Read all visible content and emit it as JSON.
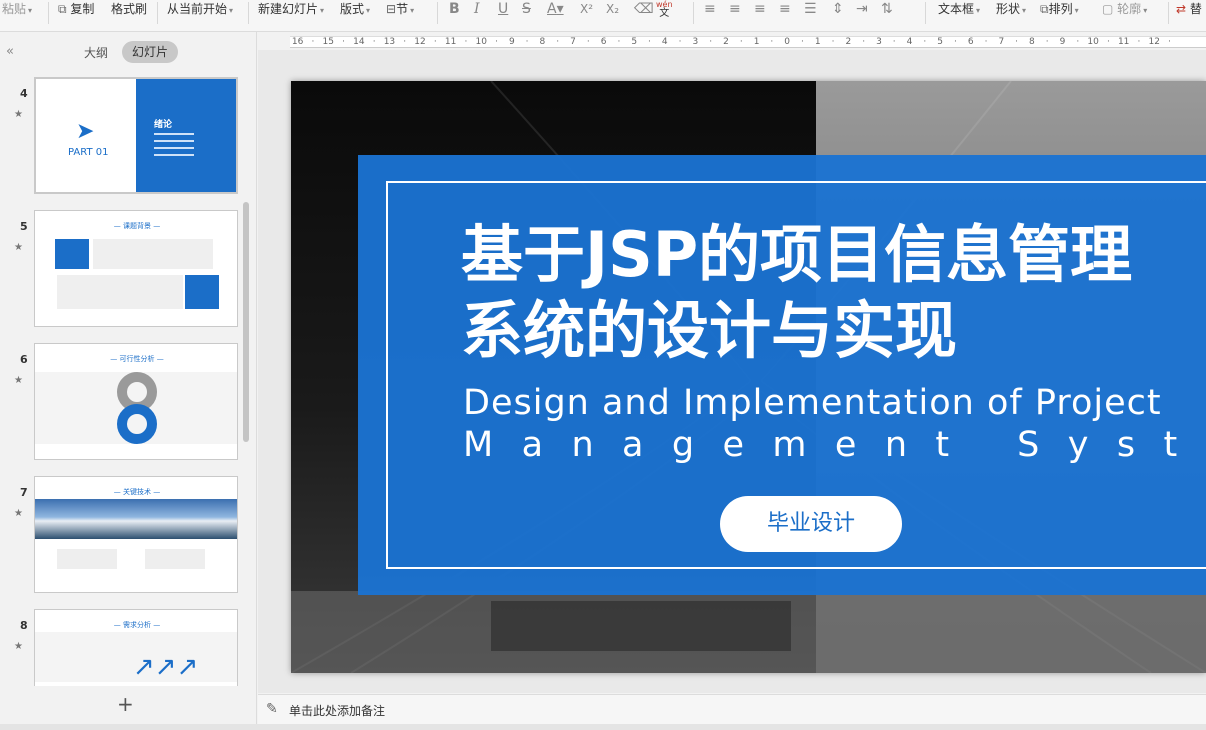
{
  "toolbar": {
    "paste": "粘贴",
    "copy": "复制",
    "format_painter": "格式刷",
    "play_from_current": "从当前开始",
    "new_slide": "新建幻灯片",
    "layout": "版式",
    "section": "节",
    "bold": "B",
    "italic": "I",
    "underline": "U",
    "strike": "S",
    "font_color": "A",
    "superscript": "X²",
    "subscript": "X₂",
    "pinyin_top": "wén",
    "pinyin_bottom": "文",
    "textbox": "文本框",
    "shape": "形状",
    "arrange": "排列",
    "outline": "轮廓",
    "replace": "替"
  },
  "sidebar": {
    "collapse_glyph": "«",
    "tab_outline": "大纲",
    "tab_slides": "幻灯片",
    "add_glyph": "+",
    "thumbs": [
      {
        "num": "4",
        "part_label": "PART 01",
        "section_title": "绪论"
      },
      {
        "num": "5",
        "title": "— 课题背景 —"
      },
      {
        "num": "6",
        "title": "— 可行性分析 —"
      },
      {
        "num": "7",
        "title": "— 关键技术 —"
      },
      {
        "num": "8",
        "title": "— 需求分析 —"
      }
    ]
  },
  "ruler": {
    "ticks": [
      "16",
      "15",
      "14",
      "13",
      "12",
      "11",
      "10",
      "9",
      "8",
      "7",
      "6",
      "5",
      "4",
      "3",
      "2",
      "1",
      "0",
      "1",
      "2",
      "3",
      "4",
      "5",
      "6",
      "7",
      "8",
      "9",
      "10",
      "11",
      "12"
    ]
  },
  "slide": {
    "title_cn_line1": "基于JSP的项目信息管理",
    "title_cn_line2": "系统的设计与实现",
    "title_en_line1": "Design and Implementation of Project",
    "title_en_line2": "Management System",
    "pill_label": "毕业设计",
    "panel_color": "#1b73d1"
  },
  "notes": {
    "placeholder": "单击此处添加备注"
  }
}
